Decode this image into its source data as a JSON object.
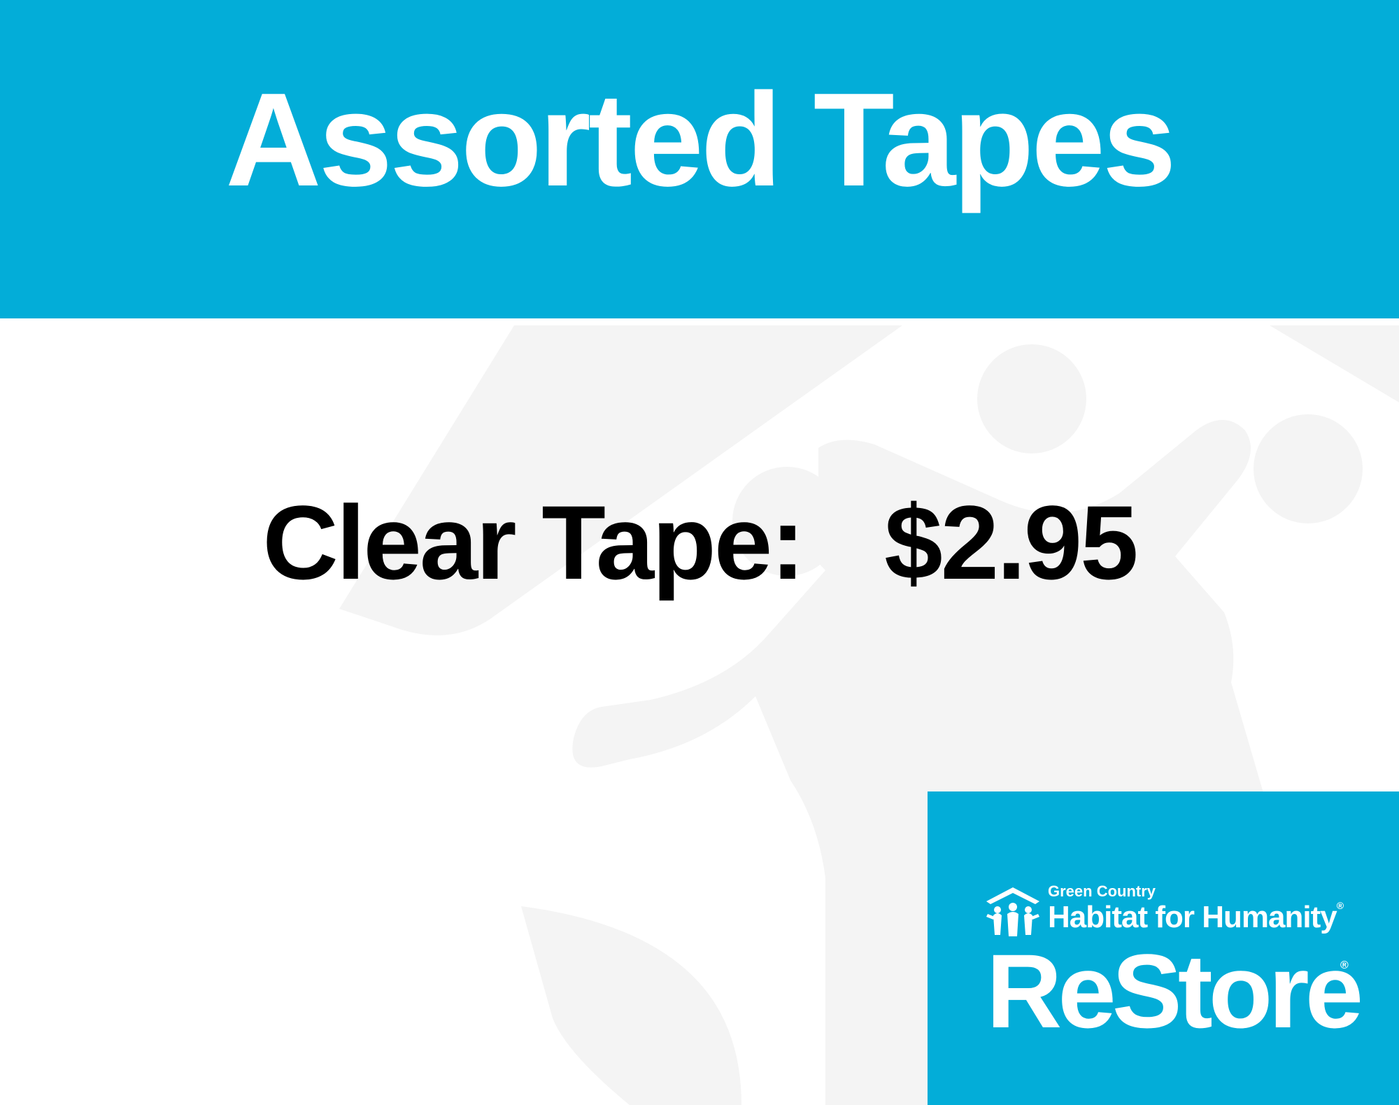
{
  "colors": {
    "brand_blue": "#03ADD8",
    "text_dark": "#000000",
    "watermark": "#F4F4F4"
  },
  "header": {
    "title": "Assorted Tapes"
  },
  "item": {
    "label": "Clear Tape:",
    "price": "$2.95"
  },
  "logo": {
    "region": "Green Country",
    "org": "Habitat for Humanity",
    "brand": "ReStore",
    "icon": "habitat-house-people-icon"
  }
}
